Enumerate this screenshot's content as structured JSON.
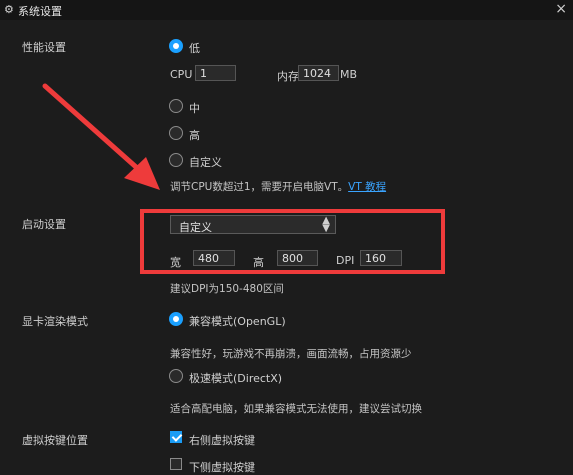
{
  "window": {
    "title": "系统设置",
    "settings_icon": "gear-icon",
    "close_label": "×"
  },
  "performance": {
    "label": "性能设置",
    "option_low": "低",
    "cpu_label": "CPU",
    "cpu_value": "1",
    "memory_label": "内存",
    "memory_value": "1024",
    "memory_unit": "MB",
    "option_mid": "中",
    "option_high": "高",
    "option_custom": "自定义",
    "vt_hint": "调节CPU数超过1，需要开启电脑VT。",
    "vt_link": "VT 教程"
  },
  "startup": {
    "label": "启动设置",
    "resolution_select": "自定义",
    "width_label": "宽",
    "width_value": "480",
    "height_label": "高",
    "height_value": "800",
    "dpi_label": "DPI",
    "dpi_value": "160",
    "dpi_hint": "建议DPI为150-480区间"
  },
  "render": {
    "label": "显卡渲染模式",
    "compat_option": "兼容模式(OpenGL)",
    "compat_desc": "兼容性好，玩游戏不再崩溃，画面流畅，占用资源少",
    "speed_option": "极速模式(DirectX)",
    "speed_desc": "适合高配电脑，如果兼容模式无法使用，建议尝试切换"
  },
  "virtual_keys": {
    "label": "虚拟按键位置",
    "right_option": "右侧虚拟按键",
    "bottom_option": "下侧虚拟按键"
  },
  "colors": {
    "accent": "#1aa0ff",
    "annotation": "#ee3b3b",
    "background": "#1c1c1c"
  }
}
